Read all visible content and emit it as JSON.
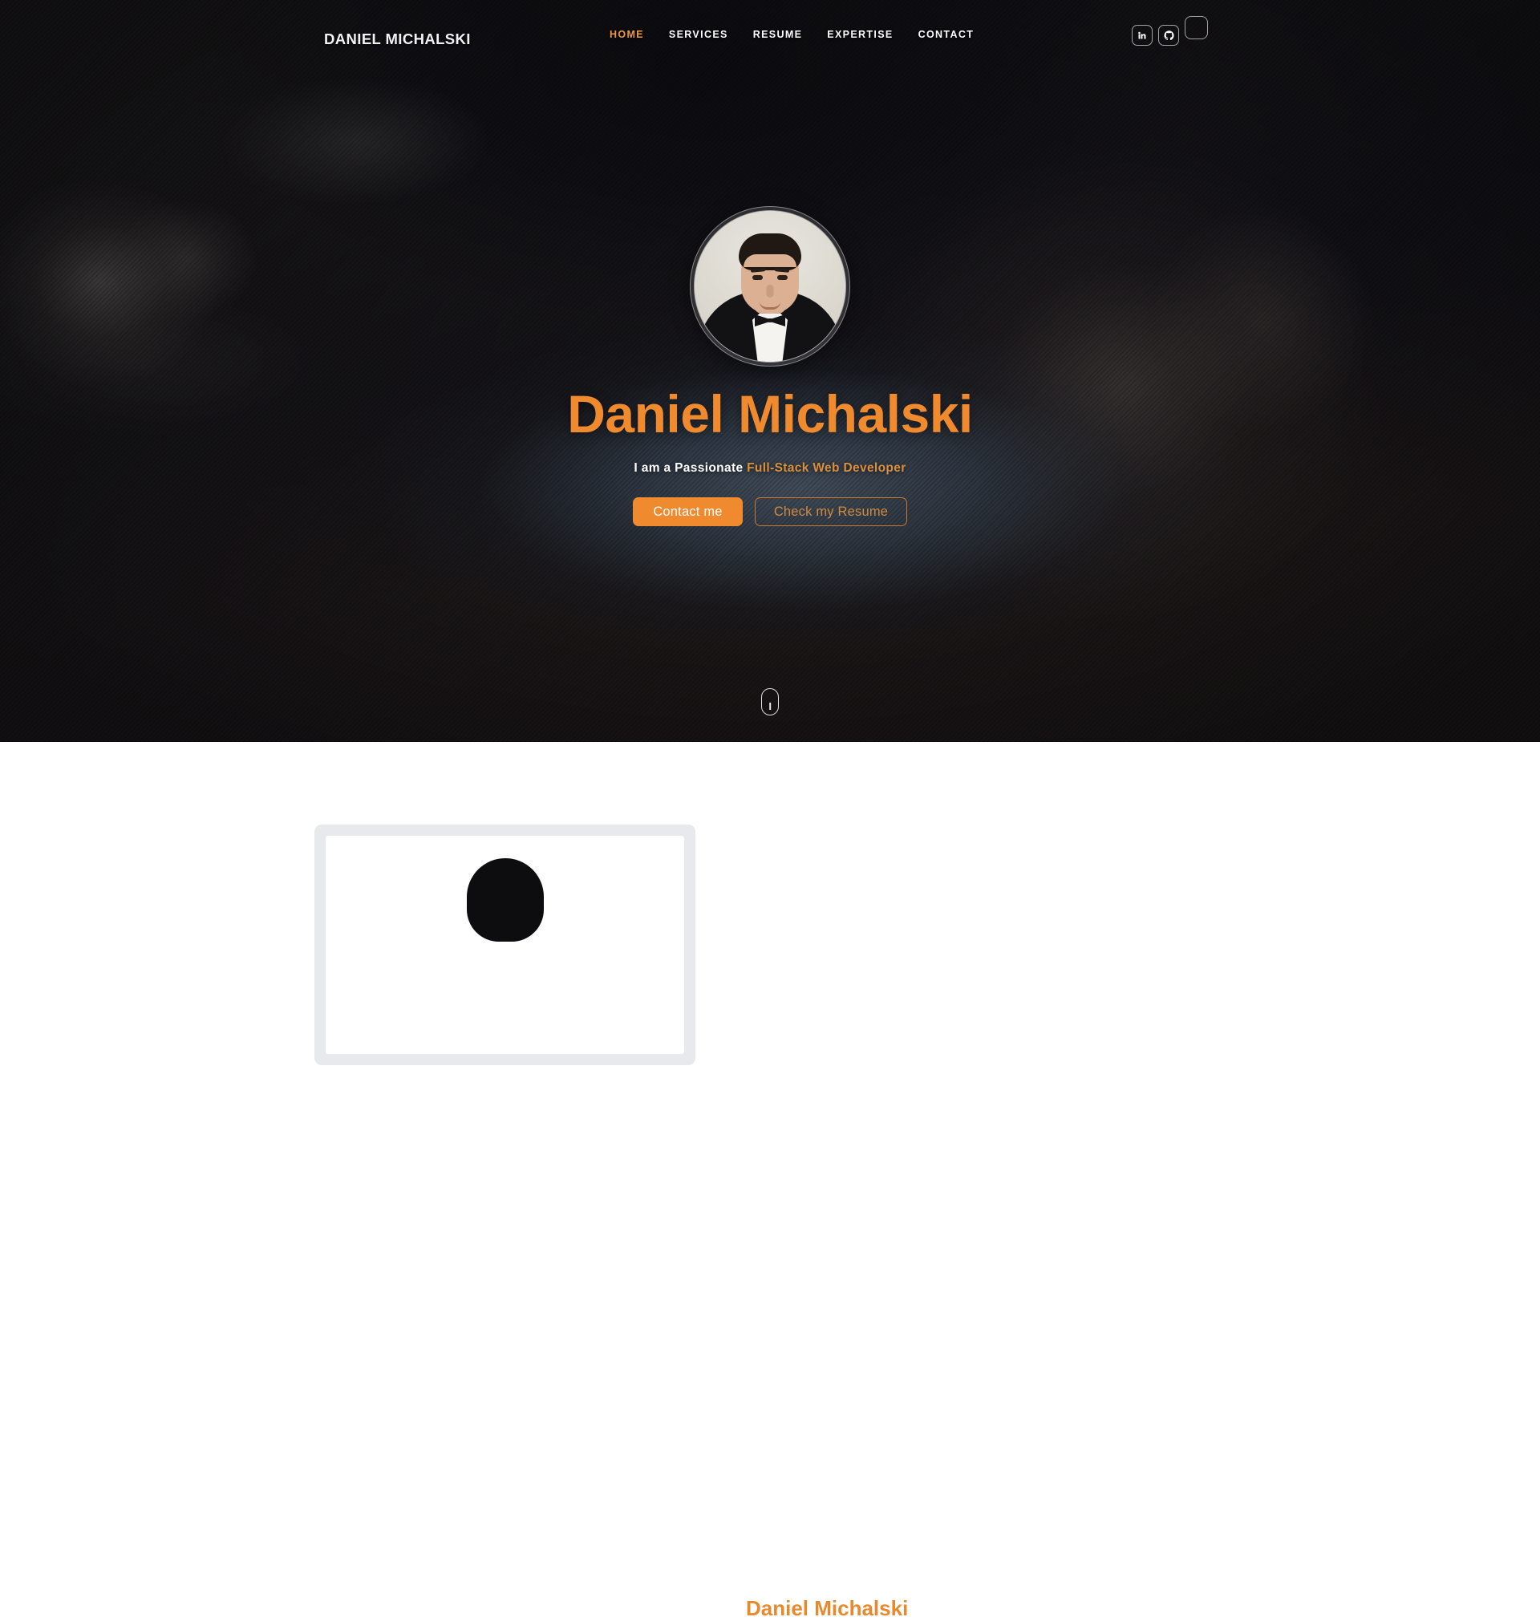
{
  "header": {
    "logo": "DANIEL MICHALSKI",
    "nav": [
      {
        "label": "HOME",
        "active": true
      },
      {
        "label": "SERVICES",
        "active": false
      },
      {
        "label": "RESUME",
        "active": false
      },
      {
        "label": "EXPERTISE",
        "active": false
      },
      {
        "label": "CONTACT",
        "active": false
      }
    ],
    "socials": [
      {
        "name": "linkedin-icon",
        "label": "in"
      },
      {
        "name": "github-icon",
        "label": ""
      },
      {
        "name": "broken-image-icon",
        "label": ""
      }
    ]
  },
  "hero": {
    "avatar_alt": "Daniel Michalski portrait",
    "title": "Daniel Michalski",
    "subtitle_prefix": "I am a Passionate ",
    "subtitle_accent": "Full-Stack Web Developer",
    "primary_button": "Contact me",
    "secondary_button": "Check my Resume",
    "scroll_hint": "scroll-down-mouse"
  },
  "about": {
    "title": "Daniel Michalski",
    "image_alt": "Daniel Michalski photo"
  },
  "colors": {
    "accent": "#f08a2e",
    "accent_muted": "#d98f3f",
    "nav_active": "#ef9740",
    "hero_bg": "#17171c",
    "section_bg": "#ffffff",
    "frame_bg": "#e7e9ec"
  }
}
